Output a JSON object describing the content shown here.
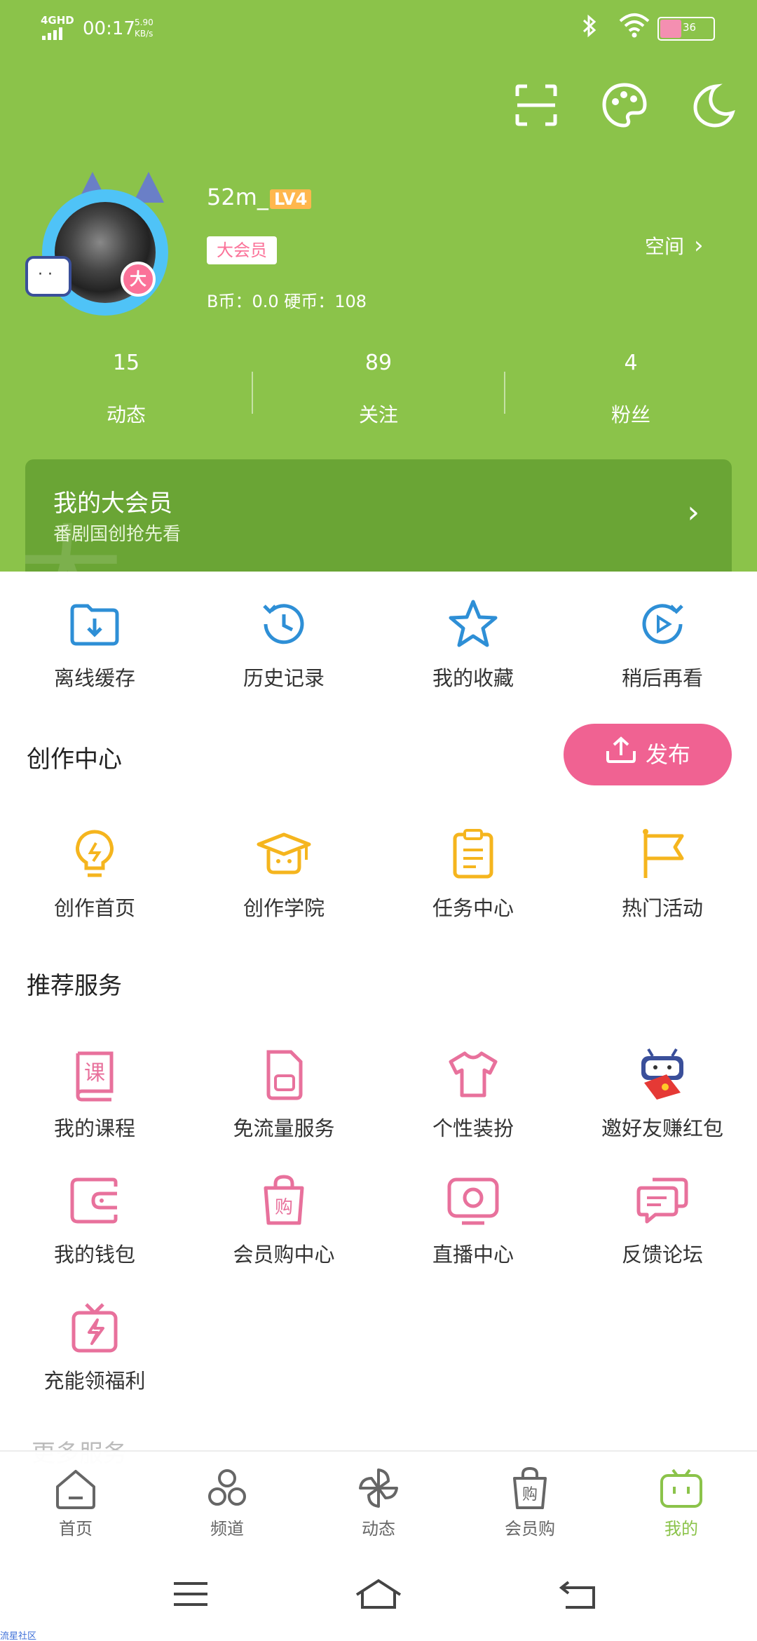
{
  "status_bar": {
    "network": "4GHD",
    "time": "00:17",
    "speed_value": "5.90",
    "speed_unit": "KB/s",
    "battery": "36"
  },
  "profile": {
    "username": "52m_",
    "level": "LV4",
    "vip_tag": "大会员",
    "coins": "B币：0.0    硬币：108",
    "space_link": "空间",
    "vip_badge": "大"
  },
  "stats": [
    {
      "num": "15",
      "label": "动态"
    },
    {
      "num": "89",
      "label": "关注"
    },
    {
      "num": "4",
      "label": "粉丝"
    }
  ],
  "vip_banner": {
    "title": "我的大会员",
    "subtitle": "番剧国创抢先看"
  },
  "quick_items": [
    {
      "label": "离线缓存",
      "icon": "download-folder-icon"
    },
    {
      "label": "历史记录",
      "icon": "clock-icon"
    },
    {
      "label": "我的收藏",
      "icon": "star-icon"
    },
    {
      "label": "稍后再看",
      "icon": "play-later-icon"
    }
  ],
  "creation": {
    "title": "创作中心",
    "publish_label": "发布",
    "items": [
      {
        "label": "创作首页",
        "icon": "lightbulb-icon"
      },
      {
        "label": "创作学院",
        "icon": "graduation-cap-icon"
      },
      {
        "label": "任务中心",
        "icon": "clipboard-icon"
      },
      {
        "label": "热门活动",
        "icon": "flag-icon"
      }
    ]
  },
  "services": {
    "title": "推荐服务",
    "items": [
      {
        "label": "我的课程",
        "icon": "course-book-icon",
        "glyph": "课"
      },
      {
        "label": "免流量服务",
        "icon": "sim-card-icon"
      },
      {
        "label": "个性装扮",
        "icon": "tshirt-icon"
      },
      {
        "label": "邀好友赚红包",
        "icon": "mascot-red-envelope-icon"
      },
      {
        "label": "我的钱包",
        "icon": "wallet-icon"
      },
      {
        "label": "会员购中心",
        "icon": "shopping-bag-icon",
        "glyph": "购"
      },
      {
        "label": "直播中心",
        "icon": "live-tv-icon"
      },
      {
        "label": "反馈论坛",
        "icon": "chat-bubbles-icon"
      },
      {
        "label": "充能领福利",
        "icon": "gift-charge-icon"
      }
    ]
  },
  "more_services_title": "更多服务",
  "bottom_nav": [
    {
      "label": "首页",
      "icon": "home-icon"
    },
    {
      "label": "频道",
      "icon": "channel-icon"
    },
    {
      "label": "动态",
      "icon": "pinwheel-icon"
    },
    {
      "label": "会员购",
      "icon": "shop-bag-icon",
      "glyph": "购"
    },
    {
      "label": "我的",
      "icon": "tv-mine-icon"
    }
  ],
  "corner_text": "流星社区",
  "colors": {
    "header": "#8bc34a",
    "blue_icons": "#2e8fd6",
    "yellow_icons": "#f5b51e",
    "pink_icons": "#e8719c",
    "publish": "#f06292"
  }
}
